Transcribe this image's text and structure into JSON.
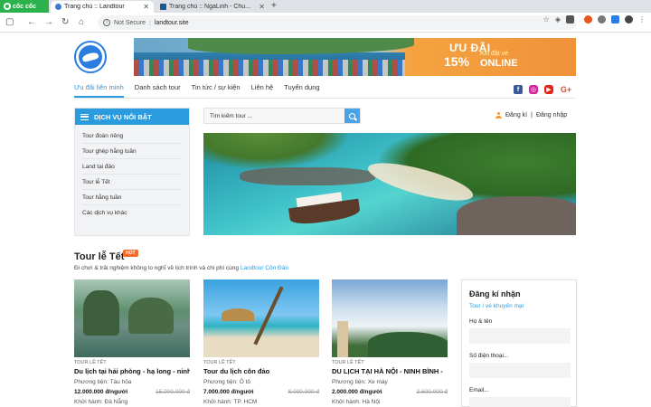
{
  "browser": {
    "brand": "cốc cốc",
    "tabs": [
      {
        "label": "Trang chủ :: Landtour",
        "active": true
      },
      {
        "label": "Trang chủ :: NgaLinh - Chu...",
        "active": false
      }
    ],
    "address": {
      "security": "Not Secure",
      "url": "landtour.site"
    }
  },
  "banner": {
    "promo_top": "ƯU ĐÃI",
    "promo_pct": "15%",
    "promo_sub": "Khi đặt vé",
    "promo_online": "ONLINE"
  },
  "nav": {
    "items": [
      "Ưu đãi liên minh",
      "Danh sách tour",
      "Tin tức / sự kiện",
      "Liên hệ",
      "Tuyển dụng"
    ]
  },
  "social": {
    "google_plus": "G+"
  },
  "sidebar": {
    "title": "DỊCH VỤ NỔI BẬT",
    "items": [
      "Tour đoàn riêng",
      "Tour ghép hằng tuần",
      "Land tại đảo",
      "Tour lễ Tết",
      "Tour hằng tuần",
      "Các dịch vụ khác"
    ]
  },
  "search": {
    "placeholder": "Tìm kiếm tour ..."
  },
  "auth": {
    "register": "Đăng kí",
    "divider": "|",
    "login": "Đăng nhập"
  },
  "section": {
    "title": "Tour lễ Tết",
    "badge": "HOT",
    "subtitle": "Đi chơi & trải nghiệm không lo nghĩ về lịch trình và chi phí cùng",
    "brand_link": "Landtour Côn Đảo"
  },
  "tours": [
    {
      "category": "TOUR LỄ TẾT",
      "name": "Du lịch tại hải phòng - hạ long - ninh",
      "transport": "Phương tiện: Tàu hỏa",
      "price": "12.000.000 đ/người",
      "old_price": "15.000.000 đ",
      "departure": "Khởi hành: Đà Nẵng"
    },
    {
      "category": "TOUR LỄ TẾT",
      "name": "Tour du lịch côn đảo",
      "transport": "Phương tiện: Ô tô",
      "price": "7.000.000 đ/người",
      "old_price": "8.000.000 đ",
      "departure": "Khởi hành: TP. HCM"
    },
    {
      "category": "TOUR LỄ TẾT",
      "name": "DU LỊCH TẠI HÀ NỘI - NINH BÌNH -",
      "transport": "Phương tiện: Xe máy",
      "price": "2.000.000 đ/người",
      "old_price": "2.600.000 đ",
      "departure": "Khởi hành: Hà Nội"
    }
  ],
  "register": {
    "title": "Đăng kí nhận",
    "subtitle": "Tour / vé khuyến mại",
    "fields": [
      {
        "label": "Họ & tên"
      },
      {
        "label": "Số điện thoại..."
      },
      {
        "label": "Email..."
      }
    ]
  },
  "colors": {
    "accent": "#2b9be0",
    "hot": "#f06a2a",
    "coccoc": "#2bb24c"
  }
}
